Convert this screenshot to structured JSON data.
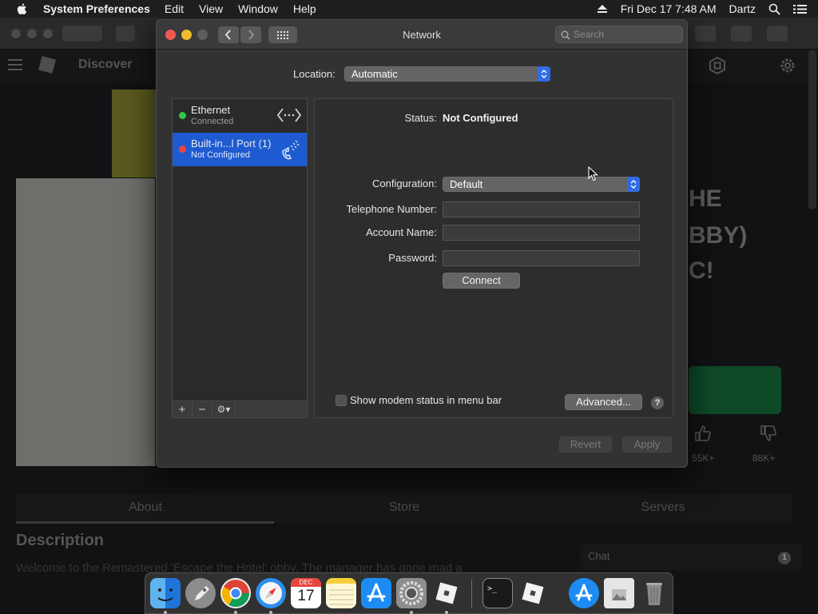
{
  "menubar": {
    "app_name": "System Preferences",
    "menus": [
      "Edit",
      "View",
      "Window",
      "Help"
    ],
    "datetime": "Fri Dec 17  7:48 AM",
    "user": "Dartz"
  },
  "background": {
    "site_label": "Discover",
    "title_fragments": [
      "HE",
      "BBY)",
      "C!"
    ],
    "votes": [
      "55K+",
      "88K+"
    ],
    "tabs": [
      "About",
      "Store",
      "Servers"
    ],
    "description_heading": "Description",
    "description_text": "Welcome to the Remastered 'Escape the Hotel' obby. The manager has gone mad a",
    "chat_label": "Chat",
    "chat_badge": "1"
  },
  "window": {
    "title": "Network",
    "search_placeholder": "Search",
    "location_label": "Location:",
    "location_value": "Automatic"
  },
  "services": [
    {
      "name": "Ethernet",
      "status": "Connected",
      "dot_color": "#2fc84a",
      "icon": "ethernet-icon"
    },
    {
      "name": "Built-in...l Port (1)",
      "status": "Not Configured",
      "dot_color": "#ee4444",
      "icon": "phone-modem-icon"
    }
  ],
  "list_tools": {
    "add": "+",
    "remove": "−",
    "gear": "⚙▾"
  },
  "detail": {
    "status_label": "Status:",
    "status_value": "Not Configured",
    "configuration_label": "Configuration:",
    "configuration_value": "Default",
    "telephone_label": "Telephone Number:",
    "account_label": "Account Name:",
    "password_label": "Password:",
    "connect_button": "Connect",
    "show_modem_label": "Show modem status in menu bar",
    "advanced_button": "Advanced...",
    "help_symbol": "?"
  },
  "footer": {
    "revert_button": "Revert",
    "apply_button": "Apply"
  },
  "dock": [
    "Finder",
    "Launchpad",
    "Chrome",
    "Safari",
    "Calendar",
    "Notes",
    "App Store",
    "System Preferences",
    "Roblox",
    "Terminal",
    "Roblox Studio",
    "Xcode",
    "Preview",
    "Trash"
  ],
  "calendar_month": "DEC",
  "calendar_day": "17"
}
